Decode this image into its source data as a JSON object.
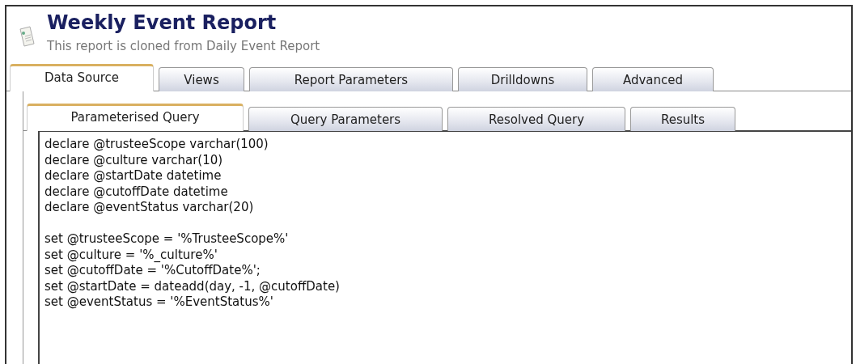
{
  "header": {
    "title": "Weekly Event Report",
    "subtitle": "This report is cloned from Daily Event Report"
  },
  "tabs": [
    {
      "label": "Data Source",
      "selected": true
    },
    {
      "label": "Views",
      "selected": false
    },
    {
      "label": "Report Parameters",
      "selected": false
    },
    {
      "label": "Drilldowns",
      "selected": false
    },
    {
      "label": "Advanced",
      "selected": false
    }
  ],
  "subtabs": [
    {
      "label": "Parameterised Query",
      "selected": true
    },
    {
      "label": "Query Parameters",
      "selected": false
    },
    {
      "label": "Resolved Query",
      "selected": false
    },
    {
      "label": "Results",
      "selected": false
    }
  ],
  "query": {
    "blocks": [
      [
        "declare @trusteeScope varchar(100)",
        "declare @culture varchar(10)",
        "declare @startDate datetime",
        "declare @cutoffDate datetime",
        "declare @eventStatus varchar(20)"
      ],
      [
        "set @trusteeScope = '%TrusteeScope%'",
        "set @culture = '%_culture%'",
        "set @cutoffDate = '%CutoffDate%';",
        "set @startDate = dateadd(day, -1, @cutoffDate)",
        "set @eventStatus = '%EventStatus%'"
      ]
    ]
  }
}
